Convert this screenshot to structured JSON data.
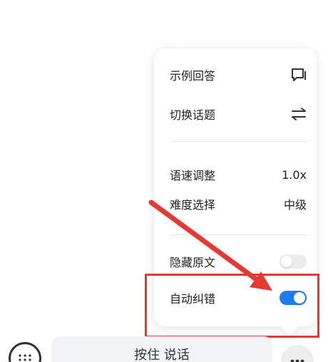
{
  "menu": {
    "items": [
      {
        "label": "示例回答",
        "icon": "reply-icon"
      },
      {
        "label": "切换话题",
        "icon": "switch-arrows-icon"
      }
    ],
    "settings": [
      {
        "label": "语速调整",
        "value": "1.0x"
      },
      {
        "label": "难度选择",
        "value": "中级"
      }
    ],
    "toggles": [
      {
        "label": "隐藏原文",
        "on": false
      },
      {
        "label": "自动纠错",
        "on": true
      }
    ]
  },
  "bottom": {
    "hold_to_talk": "按住 说话"
  },
  "colors": {
    "accent": "#1f7cf0",
    "annotation": "#e53935"
  }
}
